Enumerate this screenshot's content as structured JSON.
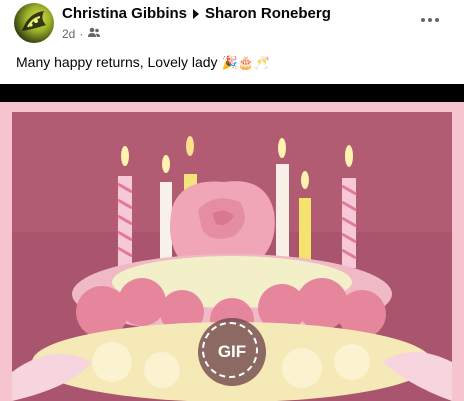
{
  "post": {
    "author": "Christina Gibbins",
    "recipient": "Sharon Roneberg",
    "time": "2d",
    "audience_icon": "friends-icon",
    "text": "Many happy returns,  Lovely lady",
    "emojis": "🎉🎂🥂"
  },
  "media": {
    "type": "gif",
    "badge_label": "GIF",
    "subject": "birthday cake with pink roses and candles"
  },
  "colors": {
    "name": "#050505",
    "meta": "#65676b",
    "frame": "#f5c4cf",
    "bar": "#000000"
  }
}
